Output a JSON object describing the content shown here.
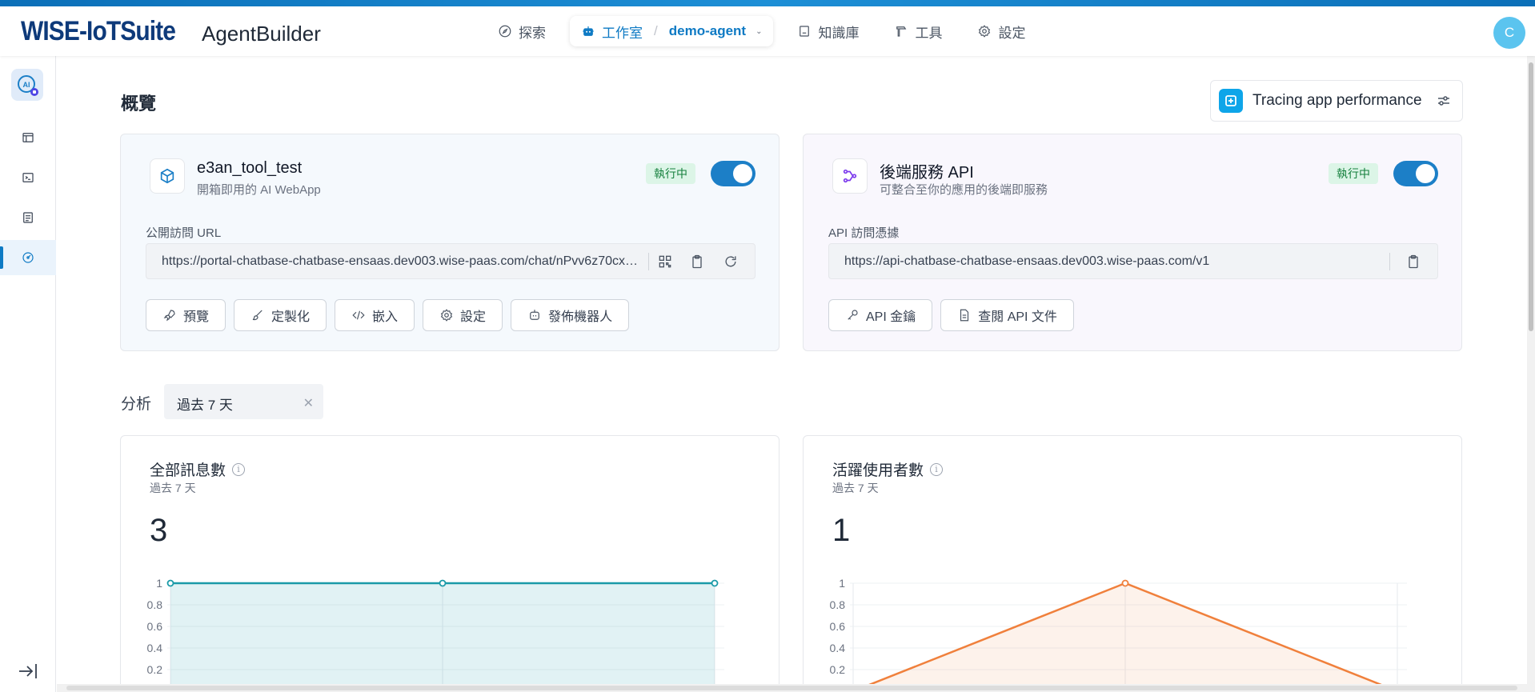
{
  "brand": {
    "name": "WISE-IoTSuite",
    "product": "AgentBuilder"
  },
  "nav": {
    "explore": "探索",
    "studio": "工作室",
    "agent": "demo-agent",
    "knowledge": "知識庫",
    "tools": "工具",
    "settings": "設定"
  },
  "user": {
    "avatar_initial": "C"
  },
  "page": {
    "title": "概覽",
    "tracing_label": "Tracing app performance"
  },
  "webapp_card": {
    "name": "e3an_tool_test",
    "subtitle": "開箱即用的 AI WebApp",
    "status": "執行中",
    "field_label": "公開訪問 URL",
    "url": "https://portal-chatbase-chatbase-ensaas.dev003.wise-paas.com/chat/nPvv6z70cxg...",
    "buttons": {
      "preview": "預覽",
      "customize": "定製化",
      "embed": "嵌入",
      "settings": "設定",
      "publish": "發佈機器人"
    }
  },
  "api_card": {
    "name": "後端服務 API",
    "subtitle": "可整合至你的應用的後端即服務",
    "status": "執行中",
    "field_label": "API 訪問憑據",
    "url": "https://api-chatbase-chatbase-ensaas.dev003.wise-paas.com/v1",
    "buttons": {
      "api_key": "API 金鑰",
      "docs": "查閱 API 文件"
    }
  },
  "analysis": {
    "label": "分析",
    "range": "過去 7 天"
  },
  "colors": {
    "accent": "#0e7ac4",
    "teal": "#1a9aa8",
    "orange": "#f0803c",
    "running_bg": "#dcf5e7"
  },
  "chart_data": [
    {
      "type": "area",
      "title": "全部訊息數",
      "subtitle": "過去 7 天",
      "total": "3",
      "y_ticks": [
        "1",
        "0.8",
        "0.6",
        "0.4",
        "0.2"
      ],
      "ylim": [
        0,
        1
      ],
      "values": [
        1,
        1,
        1
      ],
      "grid": true
    },
    {
      "type": "area",
      "title": "活躍使用者數",
      "subtitle": "過去 7 天",
      "total": "1",
      "y_ticks": [
        "1",
        "0.8",
        "0.6",
        "0.4",
        "0.2"
      ],
      "ylim": [
        0,
        1
      ],
      "values": [
        0,
        1,
        0
      ],
      "grid": true
    }
  ]
}
